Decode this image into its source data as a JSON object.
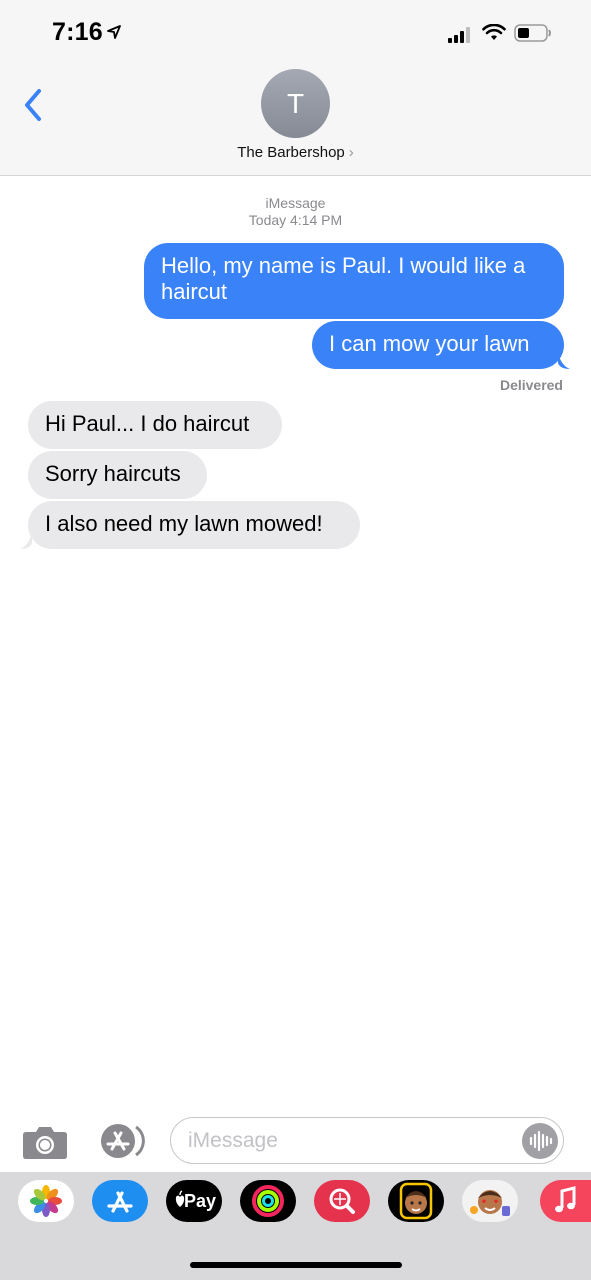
{
  "status_bar": {
    "time": "7:16"
  },
  "header": {
    "avatar_initial": "T",
    "contact_name": "The Barbershop",
    "chevron": "›"
  },
  "thread": {
    "service": "iMessage",
    "timestamp": "Today 4:14 PM",
    "outgoing": [
      {
        "text_line1": "Hello, my name is Paul. I would like a",
        "text_line2": "haircut"
      },
      {
        "text": "I can mow your lawn"
      }
    ],
    "delivered": "Delivered",
    "incoming": [
      {
        "text": "Hi Paul... I do haircut"
      },
      {
        "text": "Sorry haircuts"
      },
      {
        "text": "I also need my lawn mowed!"
      }
    ]
  },
  "composer": {
    "placeholder": "iMessage"
  },
  "drawer": {
    "apps": [
      "photos-icon",
      "app-store-icon",
      "apple-pay-icon",
      "activity-icon",
      "search-images-icon",
      "memoji-icon",
      "animoji-stickers-icon",
      "music-icon"
    ],
    "applepay_label": "Pay"
  },
  "colors": {
    "accent": "#3a82f7",
    "incoming_bubble": "#e9e9eb"
  }
}
